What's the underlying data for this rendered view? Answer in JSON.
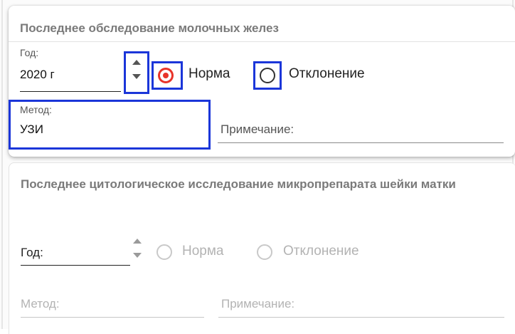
{
  "breast_exam": {
    "title": "Последнее обследование молочных желез",
    "year_label": "Год:",
    "year_value": "2020 г",
    "option_normal": "Норма",
    "option_deviation": "Отклонение",
    "selected_option": "Норма",
    "method_label": "Метод:",
    "method_value": "УЗИ",
    "note_placeholder": "Примечание:"
  },
  "cytology_exam": {
    "title": "Последнее цитологическое исследование микропрепарата шейки матки",
    "year_label": "Год:",
    "option_normal": "Норма",
    "option_deviation": "Отклонение",
    "method_placeholder": "Метод:",
    "note_placeholder": "Примечание:"
  },
  "colors": {
    "highlight": "#1b36d9",
    "radio_checked": "#e8342a",
    "disabled_text": "#b3b3b3"
  },
  "icons": {
    "spinner": "spinner-arrows-icon",
    "radio_checked": "radio-checked-icon",
    "radio_unchecked": "radio-unchecked-icon"
  }
}
